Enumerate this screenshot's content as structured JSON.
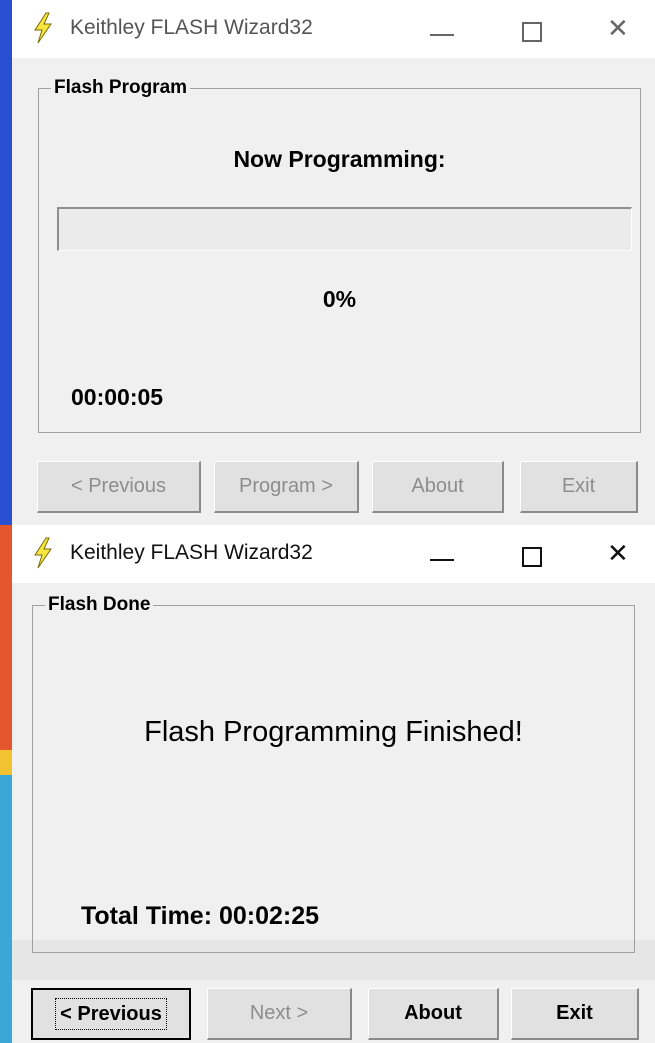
{
  "colors": {
    "window_bg": "#f0f0f0",
    "titlebar_bg": "#ffffff",
    "accent_top": "#2b4fd1",
    "accent_bottom": [
      "#e4572e",
      "#f2c230",
      "#3aa7d6"
    ],
    "disabled_text": "#8d8d8d"
  },
  "window1": {
    "title": "Keithley FLASH Wizard32",
    "icon": "lightning-bolt-icon",
    "controls": {
      "minimize": "—",
      "maximize": "☐",
      "close": "✕"
    },
    "group_label": "Flash Program",
    "status_label": "Now Programming:",
    "progress_percent_value": 0,
    "progress_percent": "0%",
    "elapsed": "00:00:05",
    "buttons": {
      "previous": "< Previous",
      "program": "Program >",
      "about": "About",
      "exit": "Exit"
    }
  },
  "window2": {
    "title": "Keithley FLASH Wizard32",
    "icon": "lightning-bolt-icon",
    "controls": {
      "minimize": "—",
      "maximize": "☐",
      "close": "✕"
    },
    "group_label": "Flash Done",
    "message": "Flash Programming Finished!",
    "total_time": "Total Time: 00:02:25",
    "buttons": {
      "previous": "< Previous",
      "next": "Next >",
      "about": "About",
      "exit": "Exit"
    }
  }
}
